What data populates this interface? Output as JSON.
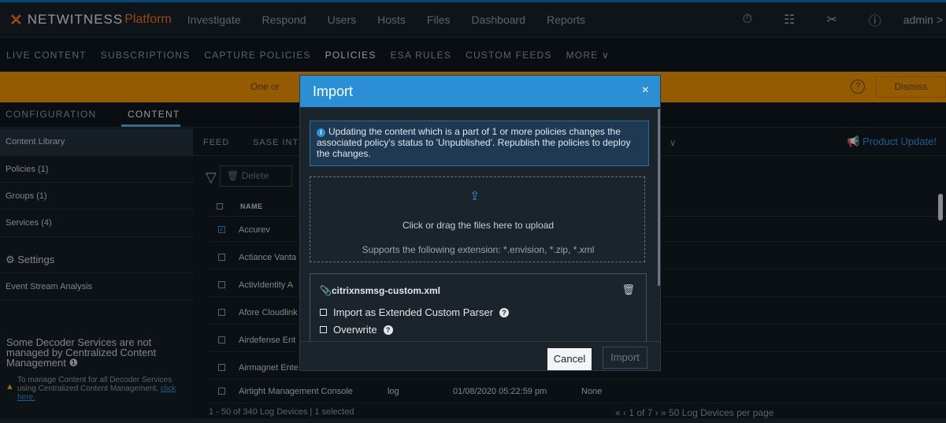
{
  "app": {
    "brand": "NETWITNESS",
    "brand_suffix": "Platform",
    "nav": [
      "Investigate",
      "Respond",
      "Users",
      "Hosts",
      "Files",
      "Dashboard",
      "Reports"
    ],
    "user": "admin >"
  },
  "subnav": [
    "LIVE CONTENT",
    "SUBSCRIPTIONS",
    "CAPTURE POLICIES",
    "POLICIES",
    "ESA RULES",
    "CUSTOM FEEDS",
    "MORE ∨"
  ],
  "banner": {
    "text": "One or",
    "dismiss": "Dismiss"
  },
  "tabs": {
    "configuration": "CONFIGURATION",
    "content": "CONTENT"
  },
  "sidebar": {
    "items": [
      {
        "label": "Content Library"
      },
      {
        "label": "Policies (1)"
      },
      {
        "label": "Groups (1)"
      },
      {
        "label": "Services (4)"
      },
      {
        "label": "⚙ Settings"
      },
      {
        "label": "Event Stream Analysis"
      }
    ],
    "note_title": "Some Decoder Services are not managed by Centralized Content Management ❶",
    "note_sub": "To manage Content for all Decoder Services using Centralized Content Management,",
    "note_link": "click here."
  },
  "main": {
    "subtabs": [
      "FEED",
      "SASE INT"
    ],
    "product_update": "Product Update!",
    "delete_label": "🗑 Delete",
    "header_name": "NAME",
    "rows": [
      {
        "name": "Accurev",
        "type": "",
        "date": "",
        "policy": ""
      },
      {
        "name": "Actiance Vanta",
        "type": "",
        "date": "",
        "policy": ""
      },
      {
        "name": "ActivIdentity A",
        "type": "",
        "date": "",
        "policy": ""
      },
      {
        "name": "Afore Cloudlink",
        "type": "",
        "date": "",
        "policy": ""
      },
      {
        "name": "Airdefense Ent",
        "type": "",
        "date": "",
        "policy": ""
      },
      {
        "name": "Airmagnet Ente",
        "type": "",
        "date": "",
        "policy": ""
      },
      {
        "name": "Airtight Management Console",
        "type": "log",
        "date": "01/08/2020 05:22:59 pm",
        "policy": "None"
      }
    ],
    "footer": "1 - 50 of 340 Log Devices | 1 selected",
    "pager": "«  ‹   1   of 7  ›  »   50      Log Devices per page"
  },
  "modal": {
    "title": "Import",
    "close": "×",
    "info": "Updating the content which is a part of 1 or more policies changes the associated policy's status to 'Unpublished'. Republish the policies to deploy the changes.",
    "drop_main": "Click or drag the files here to upload",
    "drop_sub": "Supports the following extension: *.envision, *.zip, *.xml",
    "file_name": "citrixnsmsg-custom.xml",
    "opt_extended": "Import as Extended Custom Parser",
    "opt_overwrite": "Overwrite",
    "cancel": "Cancel",
    "import": "Import"
  }
}
